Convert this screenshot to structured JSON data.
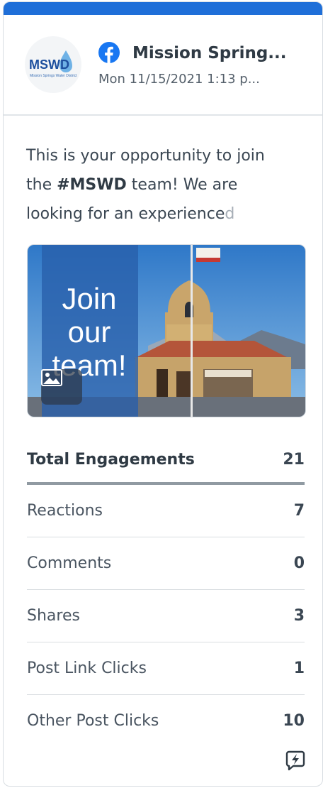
{
  "post": {
    "account_name": "Mission Spring...",
    "date": "Mon 11/15/2021 1:13 p...",
    "body_line1": "This is your opportunity to join",
    "body_line2_prefix": "the ",
    "hashtag": "#MSWD",
    "body_line2_suffix": " team! We are",
    "body_line3_main": "looking for an experience",
    "body_line3_fade": "d",
    "image_text": "Join our team!",
    "logo_text": "MSWD",
    "logo_subtext": "Mission Springs Water District"
  },
  "stats": [
    {
      "label": "Total Engagements",
      "value": "21"
    },
    {
      "label": "Reactions",
      "value": "7"
    },
    {
      "label": "Comments",
      "value": "0"
    },
    {
      "label": "Shares",
      "value": "3"
    },
    {
      "label": "Post Link Clicks",
      "value": "1"
    },
    {
      "label": "Other Post Clicks",
      "value": "10"
    }
  ],
  "icons": {
    "network": "facebook-icon",
    "media": "image-icon",
    "insight": "lightning-chat-icon"
  },
  "colors": {
    "accent": "#1f6fd8",
    "facebook": "#1877f2"
  }
}
